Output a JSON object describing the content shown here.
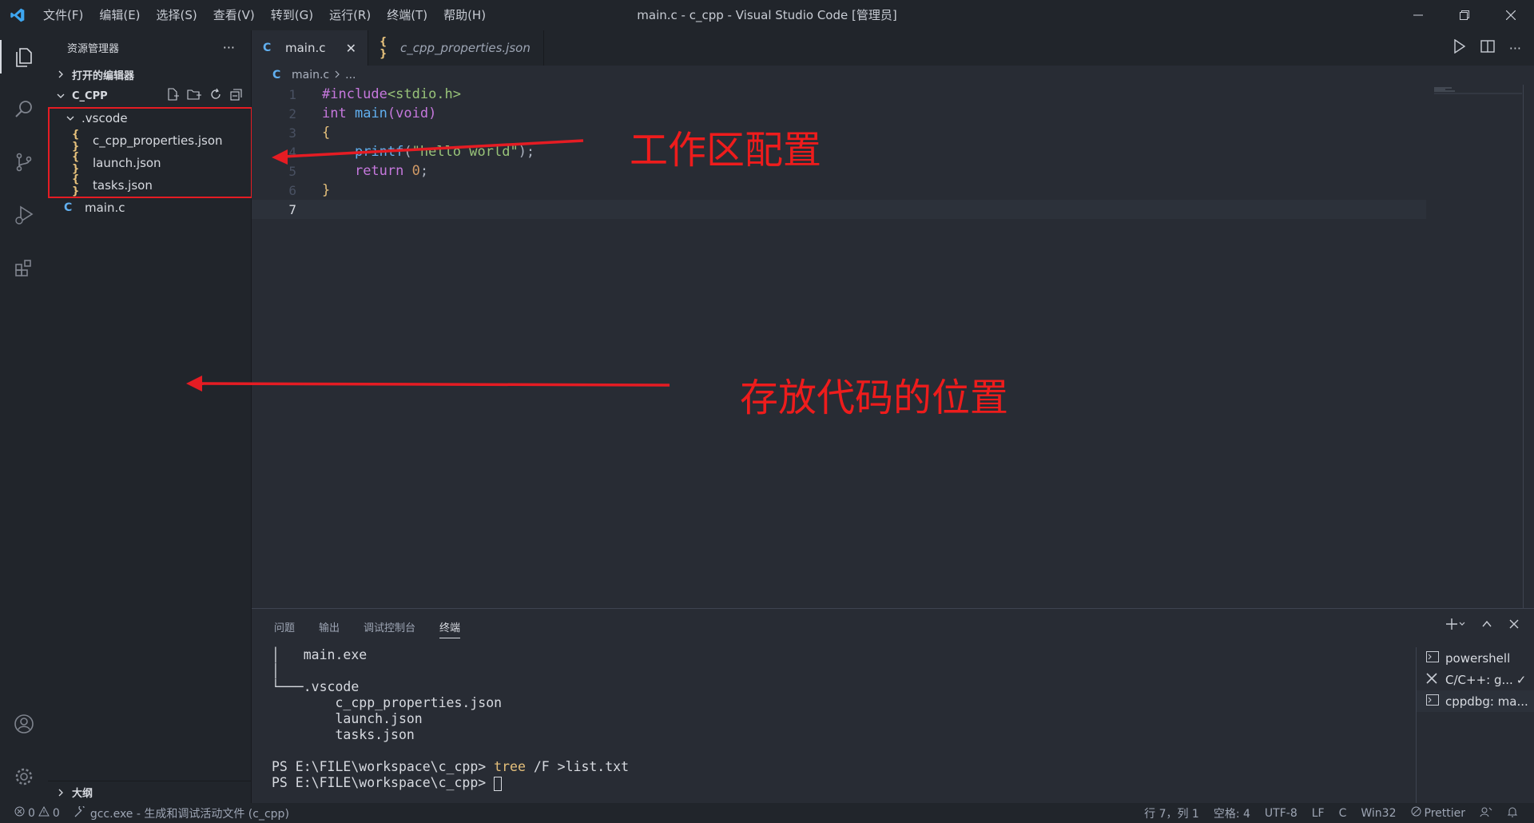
{
  "titlebar": {
    "menus": [
      "文件(F)",
      "编辑(E)",
      "选择(S)",
      "查看(V)",
      "转到(G)",
      "运行(R)",
      "终端(T)",
      "帮助(H)"
    ],
    "title": "main.c - c_cpp - Visual Studio Code [管理员]"
  },
  "sidebar": {
    "header": "资源管理器",
    "open_editors": "打开的编辑器",
    "folder": "C_CPP",
    "tree": [
      ".vscode",
      "c_cpp_properties.json",
      "launch.json",
      "tasks.json",
      "main.c"
    ],
    "outline": "大纲"
  },
  "tabs": [
    {
      "label": "main.c",
      "icon": "C"
    },
    {
      "label": "c_cpp_properties.json",
      "icon": "{}"
    }
  ],
  "breadcrumb": {
    "file": "main.c",
    "rest": "..."
  },
  "editor": {
    "line_numbers": [
      "1",
      "2",
      "3",
      "4",
      "5",
      "6",
      "7"
    ]
  },
  "annotations": {
    "workspace_config": "工作区配置",
    "code_location": "存放代码的位置"
  },
  "panel": {
    "tabs": [
      "问题",
      "输出",
      "调试控制台",
      "终端"
    ],
    "terminal_lines": [
      "│   main.exe",
      "│",
      "└───.vscode",
      "        c_cpp_properties.json",
      "        launch.json",
      "        tasks.json",
      ""
    ],
    "prompt1": "PS E:\\FILE\\workspace\\c_cpp> ",
    "cmd_tree": "tree",
    "cmd_rest": " /F >list.txt",
    "prompt2": "PS E:\\FILE\\workspace\\c_cpp> ",
    "terminals": [
      "powershell",
      "C/C++: g...",
      "cppdbg: ma..."
    ]
  },
  "statusbar": {
    "errors": "0",
    "warnings": "0",
    "task": "gcc.exe - 生成和调试活动文件 (c_cpp)",
    "position": "行 7，列 1",
    "spaces": "空格: 4",
    "encoding": "UTF-8",
    "eol": "LF",
    "language": "C",
    "platform": "Win32",
    "prettier": "Prettier"
  },
  "colors": {
    "accent": "#61afef",
    "annotation": "#ee1c1c",
    "background": "#282c34"
  }
}
